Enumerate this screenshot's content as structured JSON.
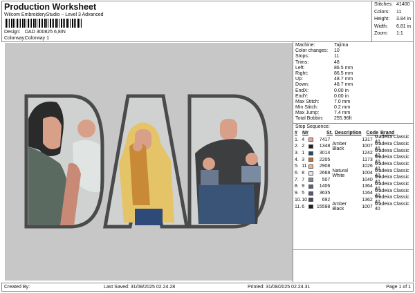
{
  "header": {
    "title": "Production Worksheet",
    "software": "Wilcom EmbroideryStudio – Level 3 Advanced",
    "design_label": "Design:",
    "design_value": "DAD 300825 6,8IN",
    "colorway_label": "Colorway:",
    "colorway_value": "Colorway 1"
  },
  "stats": [
    {
      "label": "Stitches:",
      "value": "41400"
    },
    {
      "label": "Colors:",
      "value": "11"
    },
    {
      "label": "Height:",
      "value": "3.84 in"
    },
    {
      "label": "Width:",
      "value": "6.81 in"
    },
    {
      "label": "Zoom:",
      "value": "1:1"
    }
  ],
  "info": [
    {
      "label": "Machine:",
      "value": "Tajima"
    },
    {
      "label": "Color changes:",
      "value": "10"
    },
    {
      "label": "Stops:",
      "value": "11"
    },
    {
      "label": "Trims:",
      "value": "48"
    },
    {
      "label": "Left:",
      "value": "86.5 mm"
    },
    {
      "label": "Right:",
      "value": "86.5 mm"
    },
    {
      "label": "Up:",
      "value": "48.7 mm"
    },
    {
      "label": "Down:",
      "value": "48.7 mm"
    },
    {
      "label": "EndX:",
      "value": "0.00 in"
    },
    {
      "label": "EndY:",
      "value": "0.00 in"
    },
    {
      "label": "Max Stitch:",
      "value": "7.0 mm"
    },
    {
      "label": "Min Stitch:",
      "value": "0.2 mm"
    },
    {
      "label": "Max Jump:",
      "value": "7.4 mm"
    },
    {
      "label": "Total Bobbin:",
      "value": "255.96ft"
    }
  ],
  "sequence": {
    "title": "Stop Sequence:",
    "headers": {
      "num": "#",
      "n": "N#",
      "st": "St.",
      "desc": "Description",
      "code": "Code",
      "brand": "Brand"
    },
    "rows": [
      {
        "num": "1.",
        "n": "4",
        "color": "#e8a4a4",
        "st": "7417",
        "desc": "",
        "code": "1317",
        "brand": "Madeira Classic 40"
      },
      {
        "num": "2.",
        "n": "2",
        "color": "#222222",
        "st": "1348",
        "desc": "Amber Black",
        "code": "1007",
        "brand": "Madeira Classic 40"
      },
      {
        "num": "3.",
        "n": "1",
        "color": "#2c4868",
        "st": "3014",
        "desc": "",
        "code": "1242",
        "brand": "Madeira Classic 40"
      },
      {
        "num": "4.",
        "n": "3",
        "color": "#c8702c",
        "st": "2205",
        "desc": "",
        "code": "1173",
        "brand": "Madeira Classic 40"
      },
      {
        "num": "5.",
        "n": "11",
        "color": "#f2b284",
        "st": "2908",
        "desc": "",
        "code": "1026",
        "brand": "Madeira Classic 40"
      },
      {
        "num": "6.",
        "n": "8",
        "color": "#e6e6ea",
        "st": "2668",
        "desc": "Natural White",
        "code": "1004",
        "brand": "Madeira Classic 40"
      },
      {
        "num": "7.",
        "n": "7",
        "color": "#8a8a8a",
        "st": "507",
        "desc": "",
        "code": "1040",
        "brand": "Madeira Classic 40"
      },
      {
        "num": "8.",
        "n": "9",
        "color": "#4a6888",
        "st": "1406",
        "desc": "",
        "code": "1364",
        "brand": "Madeira Classic 40"
      },
      {
        "num": "9.",
        "n": "5",
        "color": "#535c6a",
        "st": "3635",
        "desc": "",
        "code": "1164",
        "brand": "Madeira Classic 40"
      },
      {
        "num": "10.",
        "n": "10",
        "color": "#4a4862",
        "st": "692",
        "desc": "",
        "code": "1362",
        "brand": "Madeira Classic 40"
      },
      {
        "num": "11.",
        "n": "6",
        "color": "#1e1e1e",
        "st": "15598",
        "desc": "Amber Black",
        "code": "1007",
        "brand": "Madeira Classic 40"
      }
    ]
  },
  "footer": {
    "created": "Created By:",
    "saved": "Last Saved: 31/08/2025 02.24.28",
    "printed": "Printed: 31/08/2025 02.24.31",
    "page": "Page 1 of 1"
  }
}
